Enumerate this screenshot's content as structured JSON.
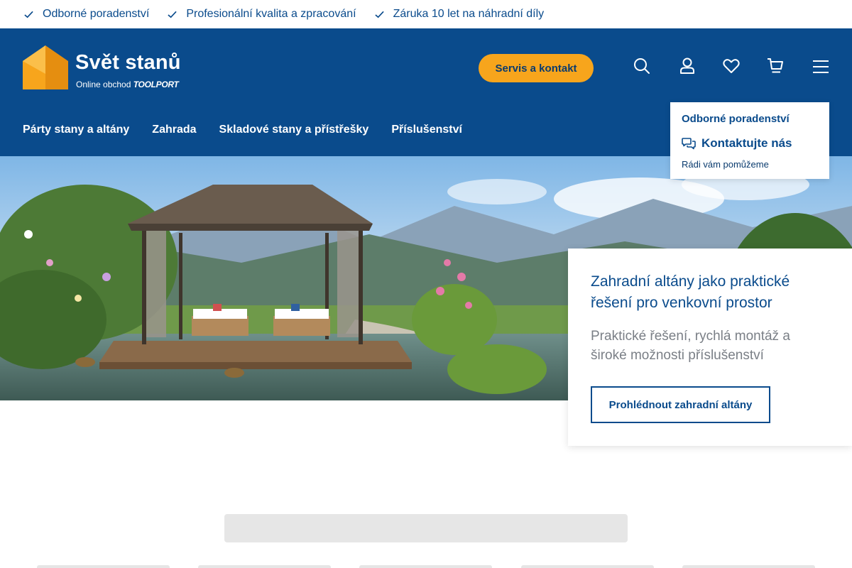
{
  "usp": [
    {
      "label": "Odborné poradenství",
      "icon": "check-icon"
    },
    {
      "label": "Profesionální kvalita a zpracování",
      "icon": "check-icon"
    },
    {
      "label": "Záruka 10 let na náhradní díly",
      "icon": "check-icon"
    }
  ],
  "logo": {
    "title": "Svět stanů",
    "sub_prefix": "Online obchod",
    "sub_brand": "TOOLPORT"
  },
  "header": {
    "service_label": "Servis a kontakt",
    "icons": [
      "search-icon",
      "user-icon",
      "heart-icon",
      "cart-icon",
      "menu-icon"
    ]
  },
  "nav": [
    {
      "label": "Párty stany a altány"
    },
    {
      "label": "Zahrada"
    },
    {
      "label": "Skladové stany a přístřešky"
    },
    {
      "label": "Příslušenství"
    }
  ],
  "dropdown": {
    "link": "Odborné poradenství",
    "contact": "Kontaktujte nás",
    "sub": "Rádi vám pomůžeme"
  },
  "hero": {
    "title": "Zahradní altány jako praktické řešení pro venkovní prostor",
    "text": "Praktické řešení, rychlá montáž a široké možnosti příslušenství",
    "button": "Prohlédnout zahradní altány"
  },
  "colors": {
    "brand_blue": "#0a4b8c",
    "accent_orange": "#f7a51c",
    "placeholder_gray": "#e6e6e6"
  }
}
